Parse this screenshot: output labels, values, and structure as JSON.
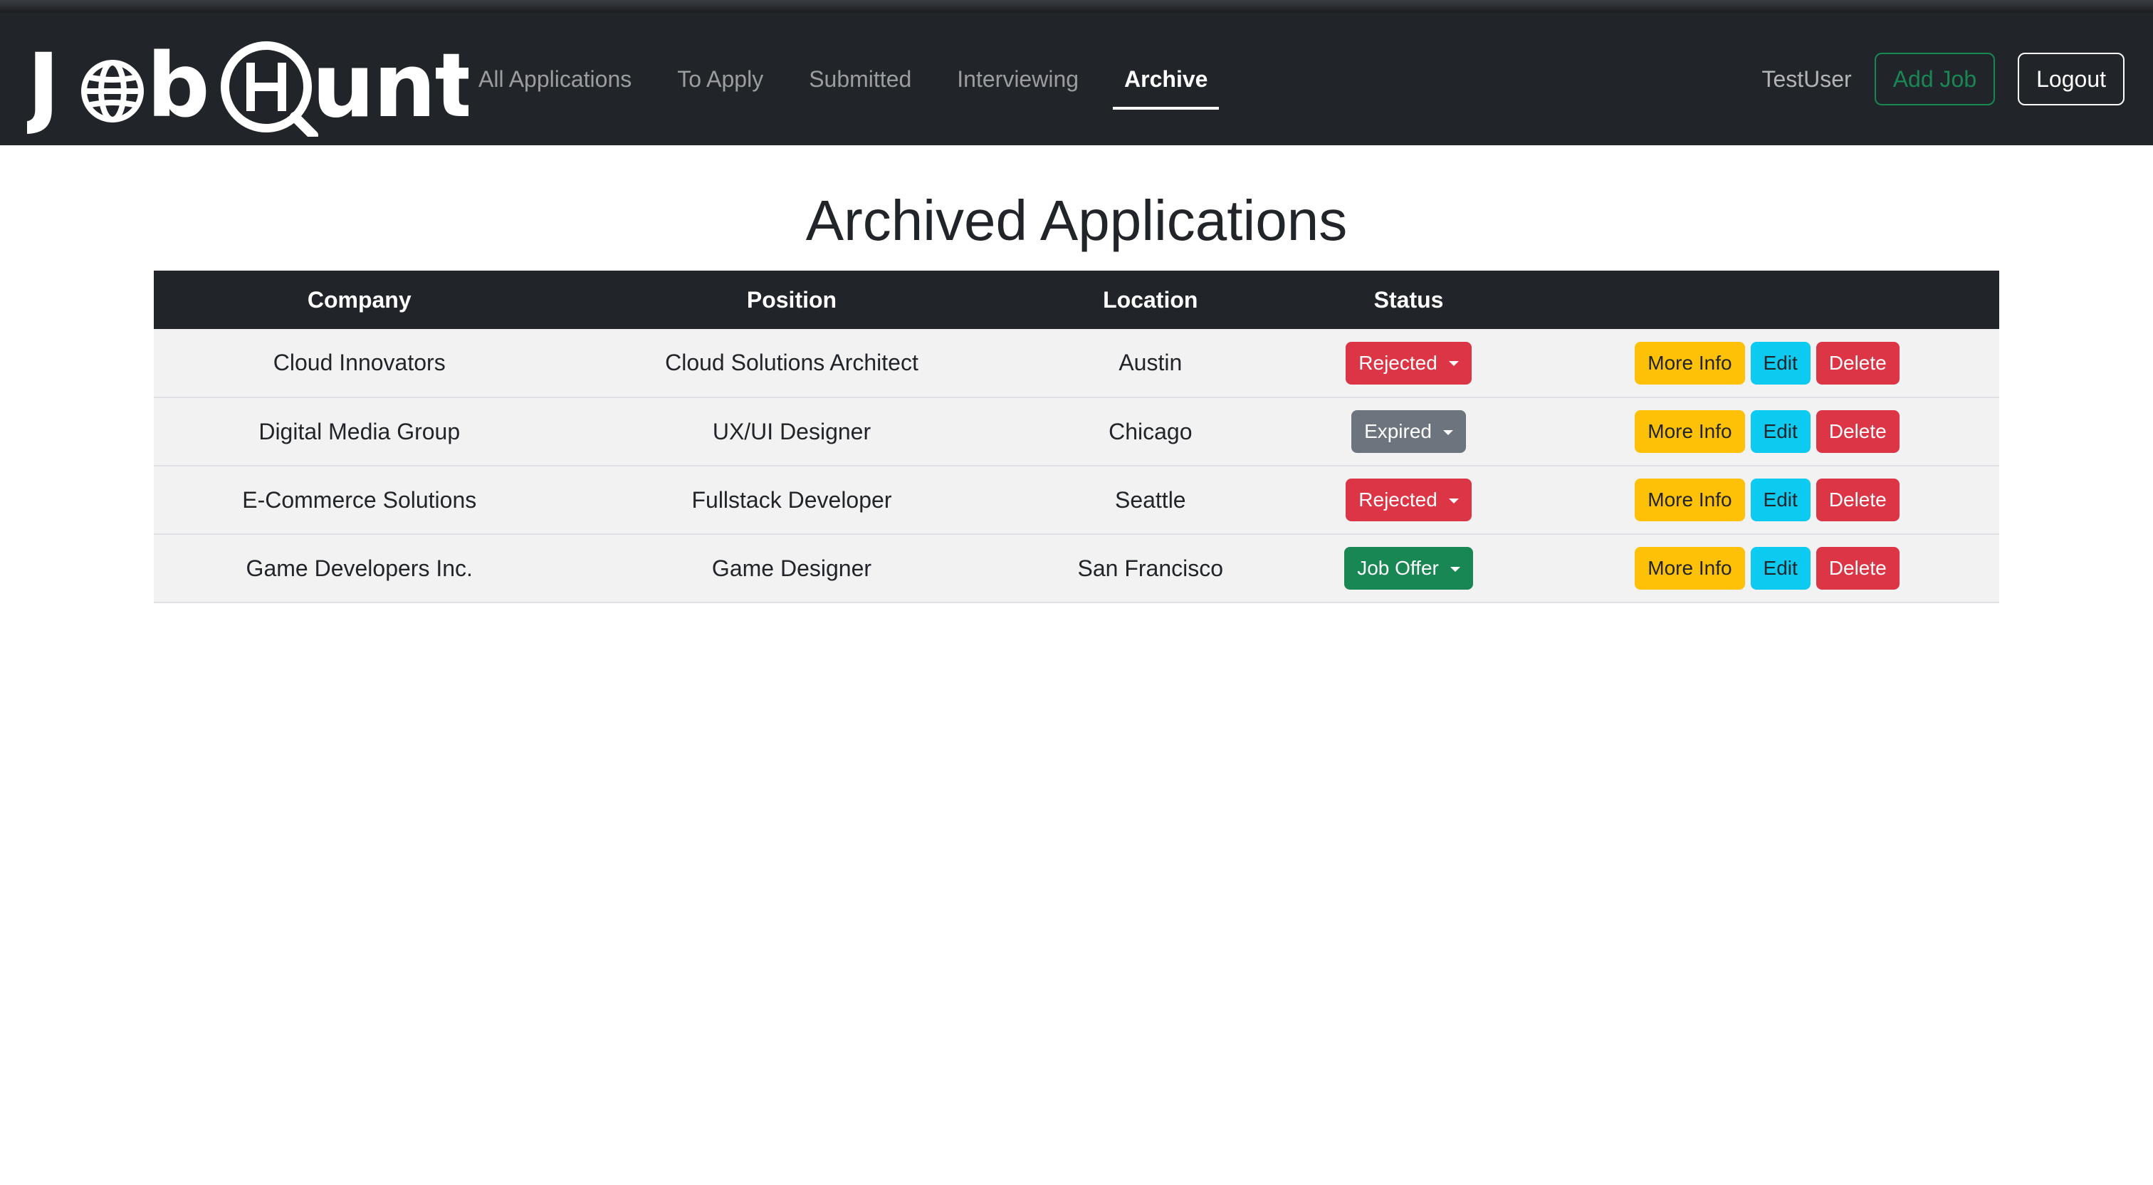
{
  "app": {
    "logo_alt": "JobHuntr"
  },
  "nav": {
    "links": [
      {
        "label": "All Applications",
        "active": false
      },
      {
        "label": "To Apply",
        "active": false
      },
      {
        "label": "Submitted",
        "active": false
      },
      {
        "label": "Interviewing",
        "active": false
      },
      {
        "label": "Archive",
        "active": true
      }
    ],
    "username": "TestUser",
    "add_job_label": "Add Job",
    "logout_label": "Logout"
  },
  "main": {
    "title": "Archived Applications",
    "table": {
      "headers": [
        "Company",
        "Position",
        "Location",
        "Status",
        ""
      ],
      "rows": [
        {
          "company": "Cloud Innovators",
          "position": "Cloud Solutions Architect",
          "location": "Austin",
          "status": "Rejected",
          "status_color": "#dc3545"
        },
        {
          "company": "Digital Media Group",
          "position": "UX/UI Designer",
          "location": "Chicago",
          "status": "Expired",
          "status_color": "#6c757d"
        },
        {
          "company": "E-Commerce Solutions",
          "position": "Fullstack Developer",
          "location": "Seattle",
          "status": "Rejected",
          "status_color": "#dc3545"
        },
        {
          "company": "Game Developers Inc.",
          "position": "Game Designer",
          "location": "San Francisco",
          "status": "Job Offer",
          "status_color": "#198754"
        }
      ],
      "actions": {
        "more_info_label": "More Info",
        "edit_label": "Edit",
        "delete_label": "Delete"
      }
    }
  },
  "colors": {
    "navbar_bg": "#212529",
    "success": "#198754",
    "danger": "#dc3545",
    "secondary": "#6c757d",
    "warning": "#ffc107",
    "info": "#0dcaf0"
  }
}
